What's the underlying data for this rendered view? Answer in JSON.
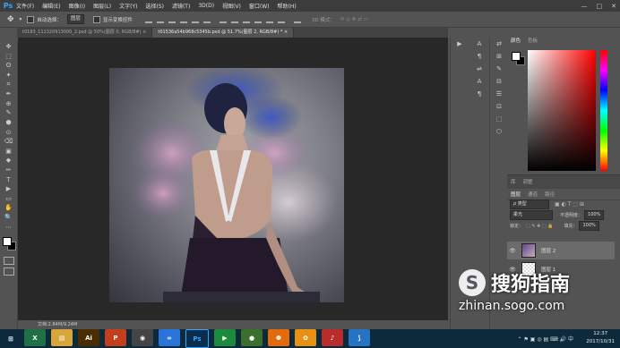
{
  "app": {
    "logo": "Ps"
  },
  "menu": [
    "文件(F)",
    "编辑(E)",
    "图像(I)",
    "图层(L)",
    "文字(Y)",
    "选择(S)",
    "滤镜(T)",
    "3D(D)",
    "视图(V)",
    "窗口(W)",
    "帮助(H)"
  ],
  "window_controls": {
    "minimize": "—",
    "maximize": "□",
    "close": "✕"
  },
  "options": {
    "auto_select_label": "自动选择：",
    "auto_select_value": "图层",
    "show_transform_label": "显示变换控件",
    "mode_3d_label": "3D 模式："
  },
  "tabs": [
    {
      "label": "t0183_111320913000_2.psd @ 50%(图层 0, RGB/8#)",
      "close": "×"
    },
    {
      "label": "t01536a54b968c5345b.psd @ 51.7%(图层 2, RGB/8#) *",
      "close": "×"
    }
  ],
  "tools": [
    "✥",
    "⬚",
    "ʘ",
    "✦",
    "⌗",
    "✒",
    "⊕",
    "✎",
    "⬢",
    "⊙",
    "⌫",
    "▣",
    "◆",
    "✏",
    "T",
    "▶",
    "▭",
    "✋",
    "🔍",
    "⋯"
  ],
  "midcol_icons": [
    "▶",
    "A",
    "¶",
    "⇌",
    "A",
    "¶",
    "⊞"
  ],
  "side_icons": [
    "⇄",
    "⊞",
    "✎",
    "⊟",
    "☰",
    "⊡",
    "⬚",
    "⬡"
  ],
  "color_panel": {
    "tab1": "颜色",
    "tab2": "色板"
  },
  "libraries": {
    "tab1": "库",
    "tab2": "调整"
  },
  "layers_panel": {
    "tabs": [
      "图层",
      "通道",
      "路径"
    ],
    "filter_label": "ρ 类型",
    "blend_mode": "柔光",
    "opacity_label": "不透明度：",
    "opacity_value": "100%",
    "lock_label": "锁定：",
    "fill_label": "填充：",
    "fill_value": "100%",
    "layers": [
      {
        "name": "图层 2",
        "visible": true,
        "selected": true
      },
      {
        "name": "图层 1",
        "visible": true,
        "selected": false
      }
    ]
  },
  "status": {
    "doc": "文档:2.84M/9.24M"
  },
  "taskbar": {
    "apps": [
      {
        "name": "excel",
        "glyph": "X",
        "color": "#1e7145"
      },
      {
        "name": "explorer",
        "glyph": "▤",
        "color": "#d9a63a"
      },
      {
        "name": "illustrator",
        "glyph": "Ai",
        "color": "#4b2b00"
      },
      {
        "name": "powerpoint",
        "glyph": "P",
        "color": "#c43e1c"
      },
      {
        "name": "app5",
        "glyph": "◉",
        "color": "#444"
      },
      {
        "name": "baidu",
        "glyph": "∞",
        "color": "#2a73d8"
      },
      {
        "name": "photoshop",
        "glyph": "Ps",
        "color": "#0a2d4e"
      },
      {
        "name": "app8",
        "glyph": "▶",
        "color": "#1b8a3a"
      },
      {
        "name": "app9",
        "glyph": "●",
        "color": "#3a6f2c"
      },
      {
        "name": "app10",
        "glyph": "Φ",
        "color": "#e36b0c"
      },
      {
        "name": "app11",
        "glyph": "✿",
        "color": "#e89012"
      },
      {
        "name": "app12",
        "glyph": "♪",
        "color": "#b82c2c"
      },
      {
        "name": "app13",
        "glyph": "⟆",
        "color": "#2573c2"
      }
    ],
    "time": "12:37",
    "date": "2017/10/31",
    "tray": "⌃ ⚑ ▣ ◎ ▤ ⌨ 🔊 中"
  },
  "watermark": {
    "brand": "搜狗指南",
    "url": "zhinan.sogo.com"
  }
}
